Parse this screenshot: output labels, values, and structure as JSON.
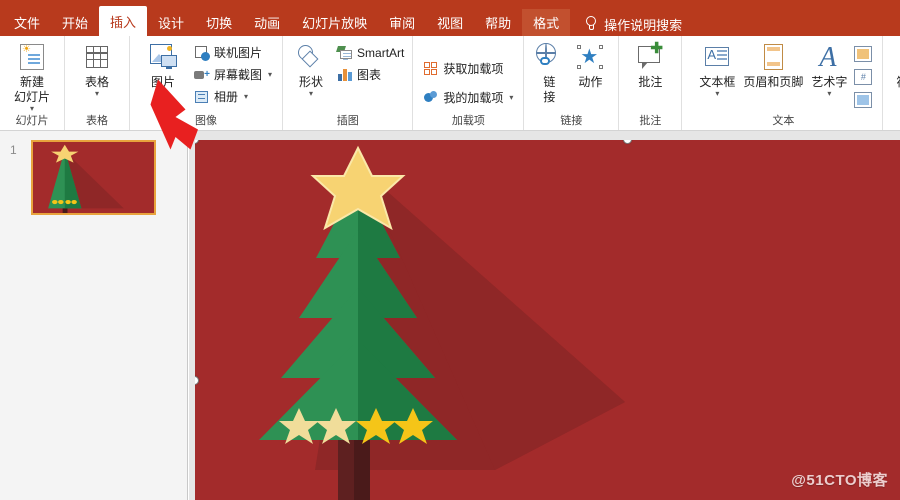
{
  "app": {
    "suite": "PowerPoint",
    "accent_red": "#b83a1d",
    "contextual_tab_bg": "#c2502f",
    "slide_bg": "#a32b2b"
  },
  "tabs": [
    {
      "label": "文件",
      "active": false,
      "contextual": false
    },
    {
      "label": "开始",
      "active": false,
      "contextual": false
    },
    {
      "label": "插入",
      "active": true,
      "contextual": false
    },
    {
      "label": "设计",
      "active": false,
      "contextual": false
    },
    {
      "label": "切换",
      "active": false,
      "contextual": false
    },
    {
      "label": "动画",
      "active": false,
      "contextual": false
    },
    {
      "label": "幻灯片放映",
      "active": false,
      "contextual": false
    },
    {
      "label": "审阅",
      "active": false,
      "contextual": false
    },
    {
      "label": "视图",
      "active": false,
      "contextual": false
    },
    {
      "label": "帮助",
      "active": false,
      "contextual": false
    },
    {
      "label": "格式",
      "active": false,
      "contextual": true
    }
  ],
  "tell_me": {
    "label": "操作说明搜索",
    "icon": "lightbulb-icon"
  },
  "ribbon": {
    "groups": [
      {
        "name": "幻灯片",
        "label": "幻灯片",
        "big_buttons": [
          {
            "label_line1": "新建",
            "label_line2": "幻灯片",
            "icon": "new-slide-icon",
            "has_caret": true
          }
        ],
        "small_buttons": []
      },
      {
        "name": "表格",
        "label": "表格",
        "big_buttons": [
          {
            "label_line1": "表格",
            "label_line2": "",
            "icon": "table-icon",
            "has_caret": true
          }
        ],
        "small_buttons": []
      },
      {
        "name": "图像",
        "label": "图像",
        "big_buttons": [
          {
            "label_line1": "图片",
            "label_line2": "",
            "icon": "picture-icon",
            "has_caret": false
          }
        ],
        "small_buttons": [
          {
            "label": "联机图片",
            "icon": "online-picture-icon",
            "has_caret": false
          },
          {
            "label": "屏幕截图",
            "icon": "screenshot-icon",
            "has_caret": true
          },
          {
            "label": "相册",
            "icon": "photo-album-icon",
            "has_caret": true
          }
        ]
      },
      {
        "name": "插图",
        "label": "插图",
        "big_buttons": [
          {
            "label_line1": "形状",
            "label_line2": "",
            "icon": "shapes-icon",
            "has_caret": true
          }
        ],
        "small_buttons": [
          {
            "label": "SmartArt",
            "icon": "smartart-icon",
            "has_caret": false
          },
          {
            "label": "图表",
            "icon": "chart-icon",
            "has_caret": false
          }
        ]
      },
      {
        "name": "加载项",
        "label": "加载项",
        "big_buttons": [],
        "small_buttons": [
          {
            "label": "获取加载项",
            "icon": "get-addins-icon",
            "has_caret": false
          },
          {
            "label": "我的加载项",
            "icon": "my-addins-icon",
            "has_caret": true
          }
        ]
      },
      {
        "name": "链接",
        "label": "链接",
        "big_buttons": [
          {
            "label_line1": "链",
            "label_line2": "接",
            "icon": "link-icon",
            "has_caret": false
          },
          {
            "label_line1": "动作",
            "label_line2": "",
            "icon": "action-icon",
            "has_caret": false
          }
        ],
        "small_buttons": []
      },
      {
        "name": "批注",
        "label": "批注",
        "big_buttons": [
          {
            "label_line1": "批注",
            "label_line2": "",
            "icon": "new-comment-icon",
            "has_caret": false
          }
        ],
        "small_buttons": []
      },
      {
        "name": "文本",
        "label": "文本",
        "big_buttons": [
          {
            "label_line1": "文本框",
            "label_line2": "",
            "icon": "text-box-icon",
            "has_caret": true
          },
          {
            "label_line1": "页眉和页脚",
            "label_line2": "",
            "icon": "header-footer-icon",
            "has_caret": false
          },
          {
            "label_line1": "艺术字",
            "label_line2": "",
            "icon": "wordart-icon",
            "has_caret": true
          }
        ],
        "small_buttons": [
          {
            "label": "",
            "icon": "date-time-icon",
            "has_caret": false
          },
          {
            "label": "",
            "icon": "slide-number-icon",
            "has_caret": false
          },
          {
            "label": "",
            "icon": "object-icon",
            "has_caret": false
          }
        ]
      },
      {
        "name": "符号",
        "label": "",
        "big_buttons": [
          {
            "label_line1": "符号",
            "label_line2": "",
            "icon": "symbol-icon",
            "has_caret": true
          }
        ],
        "small_buttons": []
      }
    ]
  },
  "thumbnail_pane": {
    "slides": [
      {
        "number": "1",
        "selected": true
      }
    ]
  },
  "slide_canvas": {
    "selected_object": "christmas-tree-picture",
    "artwork": {
      "name": "christmas-tree",
      "background_color": "#a32b2b",
      "shadow_color": "#8f2727",
      "tree_left_color": "#2e9154",
      "tree_right_color": "#1e7a42",
      "trunk_color": "#5e2020",
      "trunk_shadow_color": "#4a1a1a",
      "top_star_color": "#f7d372",
      "base_star_count": 4,
      "base_star_color": "#f5c518"
    },
    "handles": [
      {
        "name": "handle-top-left"
      },
      {
        "name": "handle-top-center"
      },
      {
        "name": "handle-middle-left"
      }
    ]
  },
  "annotation": {
    "arrow": "red-arrow-pointing-to-picture-button",
    "color": "#e82020"
  },
  "watermark": {
    "text": "@51CTO博客"
  }
}
